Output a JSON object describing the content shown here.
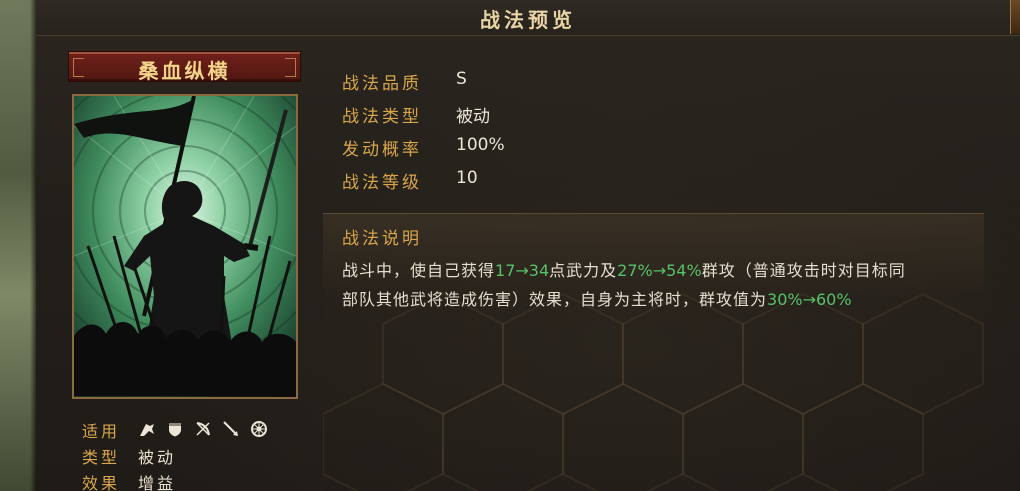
{
  "window": {
    "title": "战法预览"
  },
  "skill": {
    "name": "桑血纵横",
    "attributes": [
      {
        "label": "战法品质",
        "value": "S"
      },
      {
        "label": "战法类型",
        "value": "被动"
      },
      {
        "label": "发动概率",
        "value": "100%"
      },
      {
        "label": "战法等级",
        "value": "10"
      }
    ],
    "description": {
      "title": "战法说明",
      "line1": {
        "t1": "战斗中，使自己获得",
        "h1": "17→34",
        "t2": "点武力及",
        "h2": "27%→54%",
        "t3": "群攻（普通攻击时对目标同"
      },
      "line2": {
        "t1": "部队其他武将造成伤害）效果，自身为主将时，群攻值为",
        "h1": "30%→60%"
      }
    },
    "meta": {
      "applicable_label": "适用",
      "applicable_icons": [
        "cavalry-icon",
        "shield-icon",
        "bow-icon",
        "spear-icon",
        "siege-icon"
      ],
      "type_label": "类型",
      "type_value": "被动",
      "effect_label": "效果",
      "effect_value": "增益"
    }
  },
  "colors": {
    "accent_gold": "#d8a64a",
    "highlight_green": "#57c26a",
    "banner_red": "#6e2019",
    "card_green": "#4f9a68"
  }
}
